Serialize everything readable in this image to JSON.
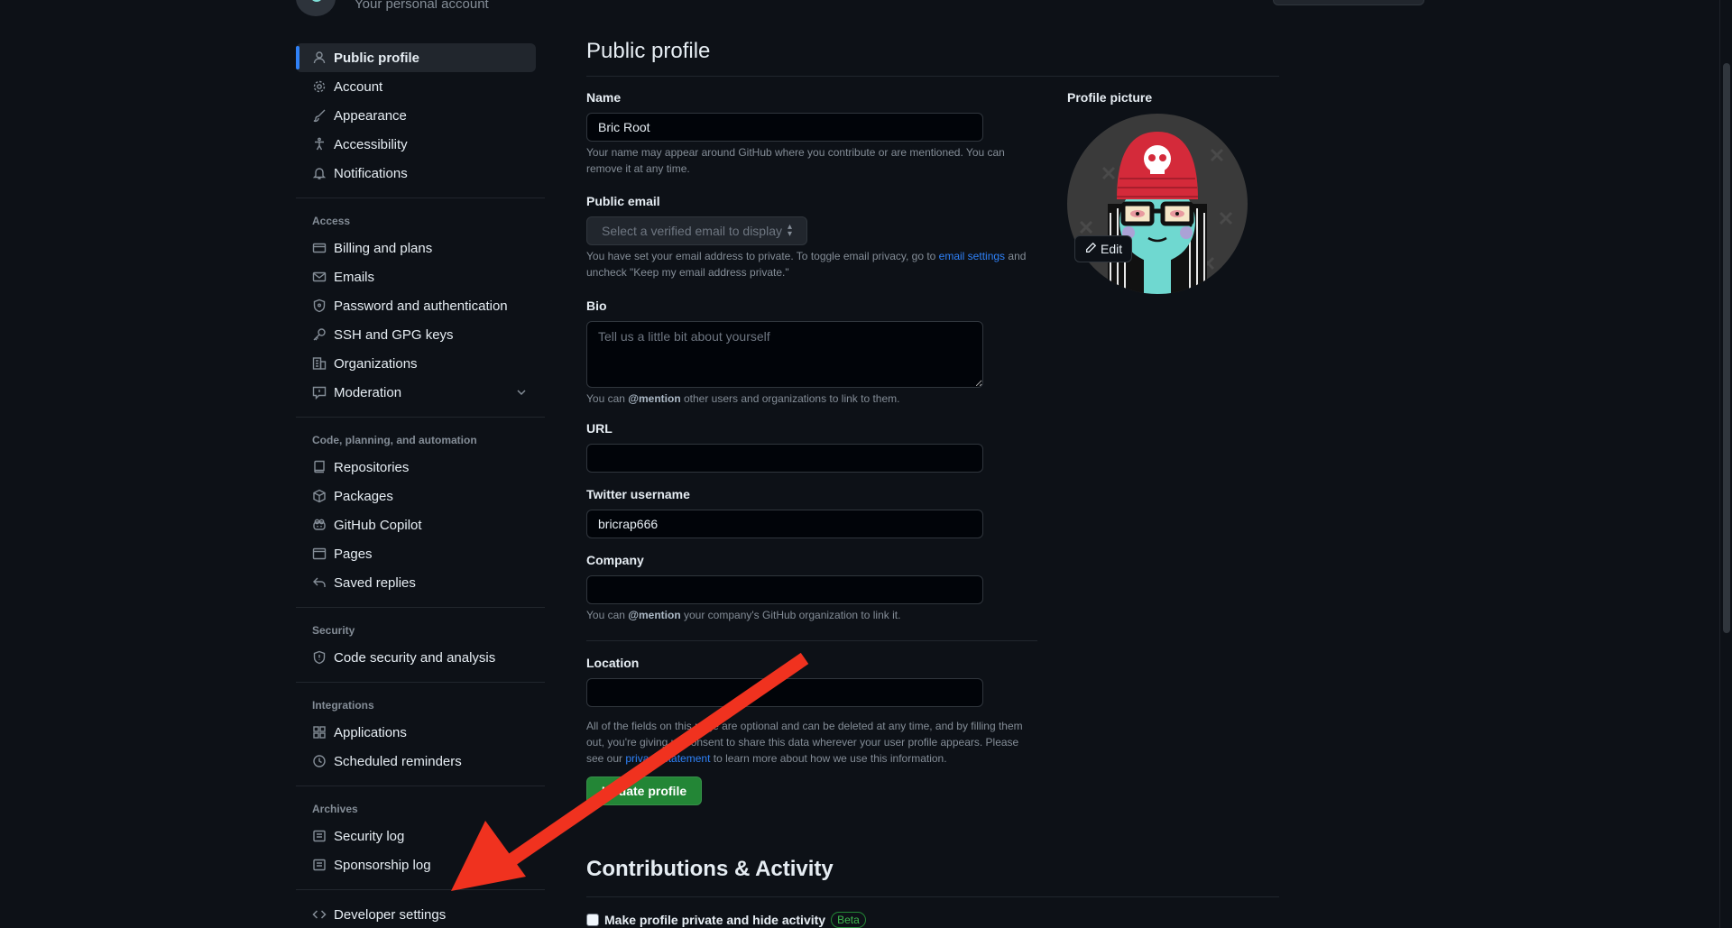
{
  "header": {
    "subtitle": "Your personal account"
  },
  "sidebar": {
    "items_top": [
      {
        "label": "Public profile",
        "icon": "person-icon",
        "active": true
      },
      {
        "label": "Account",
        "icon": "gear-icon"
      },
      {
        "label": "Appearance",
        "icon": "paintbrush-icon"
      },
      {
        "label": "Accessibility",
        "icon": "accessibility-icon"
      },
      {
        "label": "Notifications",
        "icon": "bell-icon"
      }
    ],
    "access": {
      "title": "Access",
      "items": [
        {
          "label": "Billing and plans",
          "icon": "credit-card-icon"
        },
        {
          "label": "Emails",
          "icon": "mail-icon"
        },
        {
          "label": "Password and authentication",
          "icon": "shield-lock-icon"
        },
        {
          "label": "SSH and GPG keys",
          "icon": "key-icon"
        },
        {
          "label": "Organizations",
          "icon": "organization-icon"
        },
        {
          "label": "Moderation",
          "icon": "report-icon"
        }
      ]
    },
    "code": {
      "title": "Code, planning, and automation",
      "items": [
        {
          "label": "Repositories",
          "icon": "repo-icon"
        },
        {
          "label": "Packages",
          "icon": "package-icon"
        },
        {
          "label": "GitHub Copilot",
          "icon": "copilot-icon"
        },
        {
          "label": "Pages",
          "icon": "browser-icon"
        },
        {
          "label": "Saved replies",
          "icon": "reply-icon"
        }
      ]
    },
    "security": {
      "title": "Security",
      "items": [
        {
          "label": "Code security and analysis",
          "icon": "shield-icon"
        }
      ]
    },
    "integrations": {
      "title": "Integrations",
      "items": [
        {
          "label": "Applications",
          "icon": "apps-icon"
        },
        {
          "label": "Scheduled reminders",
          "icon": "clock-icon"
        }
      ]
    },
    "archives": {
      "title": "Archives",
      "items": [
        {
          "label": "Security log",
          "icon": "log-icon"
        },
        {
          "label": "Sponsorship log",
          "icon": "log-icon"
        }
      ]
    },
    "developer": {
      "label": "Developer settings",
      "icon": "code-icon"
    }
  },
  "main": {
    "title": "Public profile",
    "name": {
      "label": "Name",
      "value": "Bric Root",
      "note": "Your name may appear around GitHub where you contribute or are mentioned. You can remove it at any time."
    },
    "email": {
      "label": "Public email",
      "placeholder": "Select a verified email to display",
      "note_before": "You have set your email address to private. To toggle email privacy, go to",
      "link": "email settings",
      "note_after": "and uncheck \"Keep my email address private.\""
    },
    "bio": {
      "label": "Bio",
      "placeholder": "Tell us a little bit about yourself",
      "note_before": "You can",
      "mention": "@mention",
      "note_after": "other users and organizations to link to them."
    },
    "url": {
      "label": "URL",
      "value": ""
    },
    "twitter": {
      "label": "Twitter username",
      "value": "bricrap666"
    },
    "company": {
      "label": "Company",
      "value": "",
      "note_before": "You can",
      "mention": "@mention",
      "note_after": "your company's GitHub organization to link it."
    },
    "location": {
      "label": "Location",
      "value": ""
    },
    "consent": {
      "before": "All of the fields on this page are optional and can be deleted at any time, and by filling them out, you're giving us consent to share this data wherever your user profile appears. Please see our",
      "link": "privacy statement",
      "after": "to learn more about how we use this information."
    },
    "update_button": "Update profile",
    "picture": {
      "label": "Profile picture",
      "edit": "Edit"
    },
    "contributions": {
      "title": "Contributions & Activity",
      "checkbox_label": "Make profile private and hide activity",
      "badge": "Beta"
    }
  },
  "colors": {
    "background": "#0d1117",
    "accent_blue": "#2f81f7",
    "green": "#238636",
    "arrow_red": "#f0321f"
  }
}
